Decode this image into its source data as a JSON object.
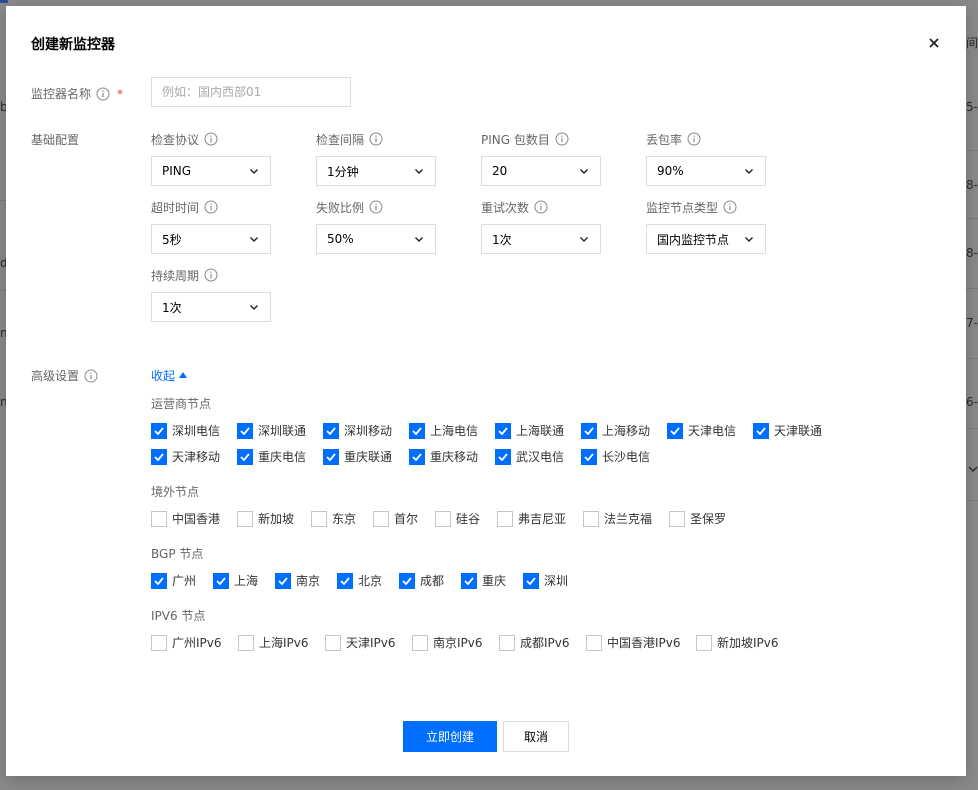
{
  "modal": {
    "title": "创建新监控器",
    "name_label": "监控器名称",
    "name_placeholder": "例如：国内西部01",
    "name_value": "",
    "basic_label": "基础配置",
    "advanced_label": "高级设置",
    "collapse_label": "收起",
    "submit_label": "立即创建",
    "cancel_label": "取消",
    "required_mark": "*"
  },
  "basic_fields": [
    {
      "label": "检查协议",
      "value": "PING"
    },
    {
      "label": "检查间隔",
      "value": "1分钟"
    },
    {
      "label": "PING 包数目",
      "value": "20"
    },
    {
      "label": "丢包率",
      "value": "90%"
    },
    {
      "label": "超时时间",
      "value": "5秒"
    },
    {
      "label": "失败比例",
      "value": "50%"
    },
    {
      "label": "重试次数",
      "value": "1次"
    },
    {
      "label": "监控节点类型",
      "value": "国内监控节点"
    },
    {
      "label": "持续周期",
      "value": "1次"
    }
  ],
  "node_groups": {
    "carrier": {
      "title": "运营商节点",
      "rows": [
        [
          {
            "label": "深圳电信",
            "checked": true
          },
          {
            "label": "深圳联通",
            "checked": true
          },
          {
            "label": "深圳移动",
            "checked": true
          },
          {
            "label": "上海电信",
            "checked": true
          },
          {
            "label": "上海联通",
            "checked": true
          },
          {
            "label": "上海移动",
            "checked": true
          },
          {
            "label": "天津电信",
            "checked": true
          },
          {
            "label": "天津联通",
            "checked": true
          }
        ],
        [
          {
            "label": "天津移动",
            "checked": true
          },
          {
            "label": "重庆电信",
            "checked": true
          },
          {
            "label": "重庆联通",
            "checked": true
          },
          {
            "label": "重庆移动",
            "checked": true
          },
          {
            "label": "武汉电信",
            "checked": true
          },
          {
            "label": "长沙电信",
            "checked": true
          }
        ]
      ]
    },
    "overseas": {
      "title": "境外节点",
      "rows": [
        [
          {
            "label": "中国香港",
            "checked": false
          },
          {
            "label": "新加坡",
            "checked": false
          },
          {
            "label": "东京",
            "checked": false
          },
          {
            "label": "首尔",
            "checked": false
          },
          {
            "label": "硅谷",
            "checked": false
          },
          {
            "label": "弗吉尼亚",
            "checked": false
          },
          {
            "label": "法兰克福",
            "checked": false
          },
          {
            "label": "圣保罗",
            "checked": false
          }
        ]
      ]
    },
    "bgp": {
      "title": "BGP 节点",
      "rows": [
        [
          {
            "label": "广州",
            "checked": true
          },
          {
            "label": "上海",
            "checked": true
          },
          {
            "label": "南京",
            "checked": true
          },
          {
            "label": "北京",
            "checked": true
          },
          {
            "label": "成都",
            "checked": true
          },
          {
            "label": "重庆",
            "checked": true
          },
          {
            "label": "深圳",
            "checked": true
          }
        ]
      ]
    },
    "ipv6": {
      "title": "IPV6 节点",
      "rows": [
        [
          {
            "label": "广州IPv6",
            "checked": false
          },
          {
            "label": "上海IPv6",
            "checked": false
          },
          {
            "label": "天津IPv6",
            "checked": false
          },
          {
            "label": "南京IPv6",
            "checked": false
          },
          {
            "label": "成都IPv6",
            "checked": false
          },
          {
            "label": "中国香港IPv6",
            "checked": false
          },
          {
            "label": "新加坡IPv6",
            "checked": false
          }
        ]
      ]
    }
  },
  "background": {
    "fragments": [
      "ba",
      "5-",
      "8-",
      "dr",
      "8-",
      "n_",
      "7-",
      "ni",
      "6-",
      "间"
    ]
  },
  "colors": {
    "primary": "#006eff",
    "required": "#e54545",
    "overlay": "#7f7f7f"
  }
}
